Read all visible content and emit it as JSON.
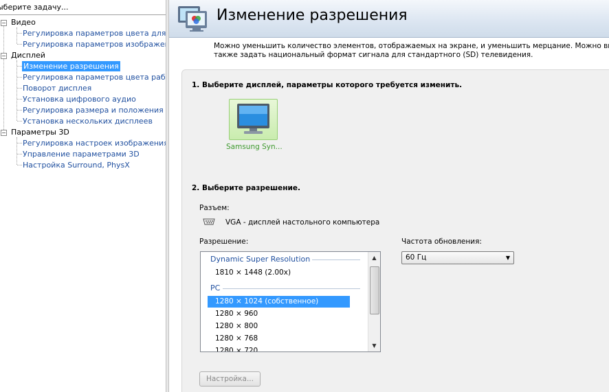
{
  "sidebar": {
    "title": "ыберите задачу...",
    "categories": [
      {
        "label": "Видео",
        "items": [
          "Регулировка параметров цвета для вид",
          "Регулировка параметров изображения д"
        ]
      },
      {
        "label": "Дисплей",
        "items": [
          "Изменение разрешения",
          "Регулировка параметров цвета рабочег",
          "Поворот дисплея",
          "Установка цифрового аудио",
          "Регулировка размера и положения рабо",
          "Установка нескольких дисплеев"
        ]
      },
      {
        "label": "Параметры 3D",
        "items": [
          "Регулировка настроек изображения с пр",
          "Управление параметрами 3D",
          "Настройка Surround, PhysX"
        ]
      }
    ],
    "expander_symbol": "−"
  },
  "page": {
    "title": "Изменение разрешения",
    "intro_line1": "Можно уменьшить количество элементов, отображаемых на экране, и уменьшить мерцание. Можно выбрать вы",
    "intro_line2": "также задать национальный формат сигнала для стандартного (SD) телевидения."
  },
  "step1": {
    "heading": "1. Выберите дисплей, параметры которого требуется изменить.",
    "display_name": "Samsung Syn..."
  },
  "step2": {
    "heading": "2. Выберите разрешение.",
    "connector_label": "Разъем:",
    "connector_value": "VGA - дисплей настольного компьютера",
    "resolution_label": "Разрешение:",
    "refresh_label": "Частота обновления:",
    "refresh_value": "60 Гц",
    "groups": [
      {
        "name": "Dynamic Super Resolution",
        "options": [
          "1810 × 1448 (2.00x)"
        ]
      },
      {
        "name": "PC",
        "options": [
          "1280 × 1024 (собственное)",
          "1280 × 960",
          "1280 × 800",
          "1280 × 768",
          "1280 × 720"
        ]
      }
    ],
    "selected_option": "1280 × 1024 (собственное)",
    "settings_button": "Настройка..."
  },
  "colors": {
    "selection": "#3399ff",
    "link_blue": "#1f4f9f",
    "display_tile": "#c9ecae"
  },
  "icons": {
    "banner": "display-settings-icon",
    "connector": "vga-connector-icon",
    "monitor": "monitor-icon"
  }
}
